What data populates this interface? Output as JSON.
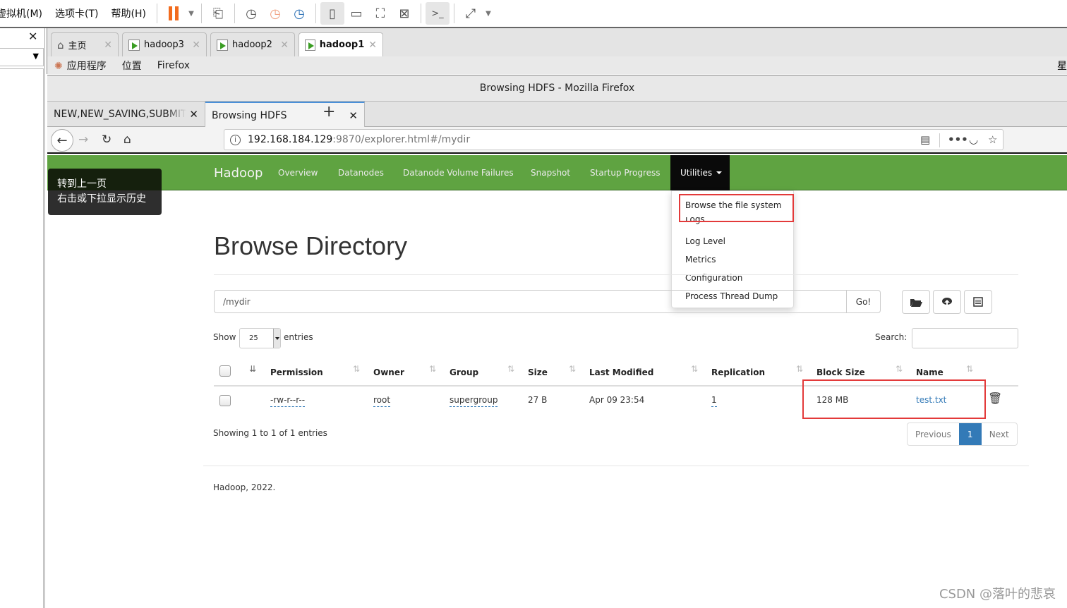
{
  "vm_toolbar": {
    "menus": [
      "虚拟机(M)",
      "选项卡(T)",
      "帮助(H)"
    ],
    "icons": [
      "pause-icon",
      "dropdown-caret-icon",
      "send-keys-icon",
      "snapshot-icon",
      "revert-snapshot-icon",
      "snapshot-manager-icon",
      "sidebar-view-icon",
      "thumbnail-view-icon",
      "fullscreen-icon",
      "unity-icon",
      "console-icon",
      "stretch-icon"
    ]
  },
  "vm_tabs": [
    {
      "label": "主页",
      "icon": "home-icon",
      "active": false
    },
    {
      "label": "hadoop3",
      "icon": "vm-icon",
      "active": false
    },
    {
      "label": "hadoop2",
      "icon": "vm-icon",
      "active": false
    },
    {
      "label": "hadoop1",
      "icon": "vm-icon",
      "active": true
    }
  ],
  "gnome_bar": {
    "items": [
      "应用程序",
      "位置",
      "Firefox"
    ],
    "right_text": "星"
  },
  "firefox": {
    "window_title": "Browsing HDFS - Mozilla Firefox",
    "tabs": [
      {
        "label": "NEW,NEW_SAVING,SUBMITTED",
        "active": false
      },
      {
        "label": "Browsing HDFS",
        "active": true
      }
    ],
    "url_host": "192.168.184.129",
    "url_rest": ":9870/explorer.html#/mydir",
    "tooltip": [
      "转到上一页",
      "右击或下拉显示历史"
    ]
  },
  "hadoop_nav": {
    "brand": "Hadoop",
    "links": [
      "Overview",
      "Datanodes",
      "Datanode Volume Failures",
      "Snapshot",
      "Startup Progress"
    ],
    "utilities": "Utilities",
    "dropdown": [
      "Browse the file system",
      "Logs",
      "Log Level",
      "Metrics",
      "Configuration",
      "Process Thread Dump"
    ]
  },
  "browse": {
    "title": "Browse Directory",
    "path": "/mydir",
    "go_label": "Go!",
    "show_label": "Show",
    "entries_per_page": "25",
    "entries_label": "entries",
    "search_label": "Search:",
    "search_value": "",
    "columns": [
      "Permission",
      "Owner",
      "Group",
      "Size",
      "Last Modified",
      "Replication",
      "Block Size",
      "Name"
    ],
    "rows": [
      {
        "permission": "-rw-r--r--",
        "owner": "root",
        "group": "supergroup",
        "size": "27 B",
        "last_modified": "Apr 09 23:54",
        "replication": "1",
        "block_size": "128 MB",
        "name": "test.txt"
      }
    ],
    "showing": "Showing 1 to 1 of 1 entries",
    "pager": {
      "previous": "Previous",
      "current": "1",
      "next": "Next"
    },
    "footer": "Hadoop, 2022."
  },
  "watermark": "CSDN @落叶的悲哀",
  "colors": {
    "nav_green": "#5fa341",
    "highlight_red": "#e33a3a",
    "link_blue": "#337ab7"
  }
}
